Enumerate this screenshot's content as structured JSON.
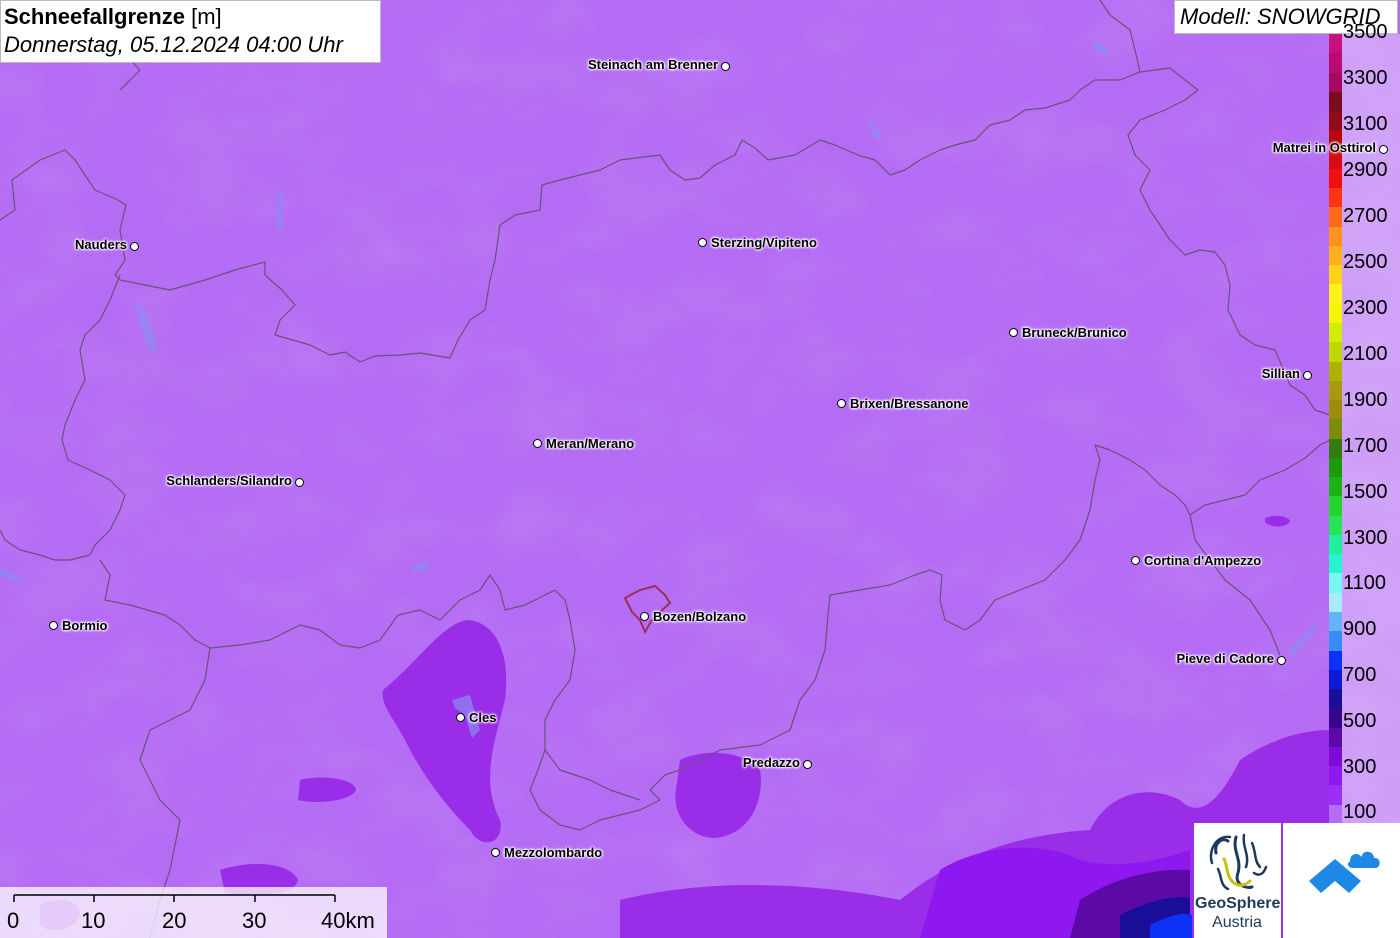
{
  "title": {
    "parameter": "Schneefallgrenze",
    "unit": "[m]",
    "datetime": "Donnerstag, 05.12.2024 04:00 Uhr"
  },
  "model_label": "Modell: SNOWGRID",
  "legend": {
    "ticks": [
      "3500",
      "3300",
      "3100",
      "2900",
      "2700",
      "2500",
      "2300",
      "2100",
      "1900",
      "1700",
      "1500",
      "1300",
      "1100",
      "900",
      "700",
      "500",
      "300",
      "100"
    ],
    "colors": [
      "#c80f80",
      "#b90b70",
      "#a40a60",
      "#7a0d1d",
      "#8f0c17",
      "#b8080f",
      "#d50d12",
      "#f01010",
      "#ff3315",
      "#ff6a1a",
      "#ff9221",
      "#ffb01f",
      "#ffd21a",
      "#fff11c",
      "#f2f50a",
      "#d4ec0a",
      "#bcd808",
      "#b0b108",
      "#a89812",
      "#9c8e0a",
      "#7a8c0a",
      "#347c0b",
      "#1b9a0c",
      "#1ab416",
      "#22d42b",
      "#27e358",
      "#1ef0a0",
      "#27f3cc",
      "#77f7f3",
      "#a6ebff",
      "#62b4f4",
      "#3a8bf2",
      "#0c33f5",
      "#0b1bd6",
      "#1a0e98",
      "#35078c",
      "#5c0aa6",
      "#7c0bd8",
      "#8f18f0",
      "#9a30f5",
      "#b56cf5"
    ]
  },
  "cities": [
    {
      "name": "Steinach am Brenner",
      "side": "left"
    },
    {
      "name": "Nauders",
      "side": "left"
    },
    {
      "name": "Sterzing/Vipiteno",
      "side": "right"
    },
    {
      "name": "Matrei in Osttirol",
      "side": "left"
    },
    {
      "name": "Bruneck/Brunico",
      "side": "right"
    },
    {
      "name": "Sillian",
      "side": "left"
    },
    {
      "name": "Brixen/Bressanone",
      "side": "right"
    },
    {
      "name": "Meran/Merano",
      "side": "right"
    },
    {
      "name": "Schlanders/Silandro",
      "side": "left"
    },
    {
      "name": "Cortina d'Ampezzo",
      "side": "right"
    },
    {
      "name": "Bormio",
      "side": "right"
    },
    {
      "name": "Bozen/Bolzano",
      "side": "right"
    },
    {
      "name": "Pieve di Cadore",
      "side": "left"
    },
    {
      "name": "Cles",
      "side": "right"
    },
    {
      "name": "Predazzo",
      "side": "left"
    },
    {
      "name": "Mezzolombardo",
      "side": "right"
    }
  ],
  "scale_bar": {
    "labels": [
      "0",
      "10",
      "20",
      "30",
      "40km"
    ]
  },
  "logos": {
    "geosphere_line1": "GeoSphere",
    "geosphere_line2": "Austria"
  }
}
